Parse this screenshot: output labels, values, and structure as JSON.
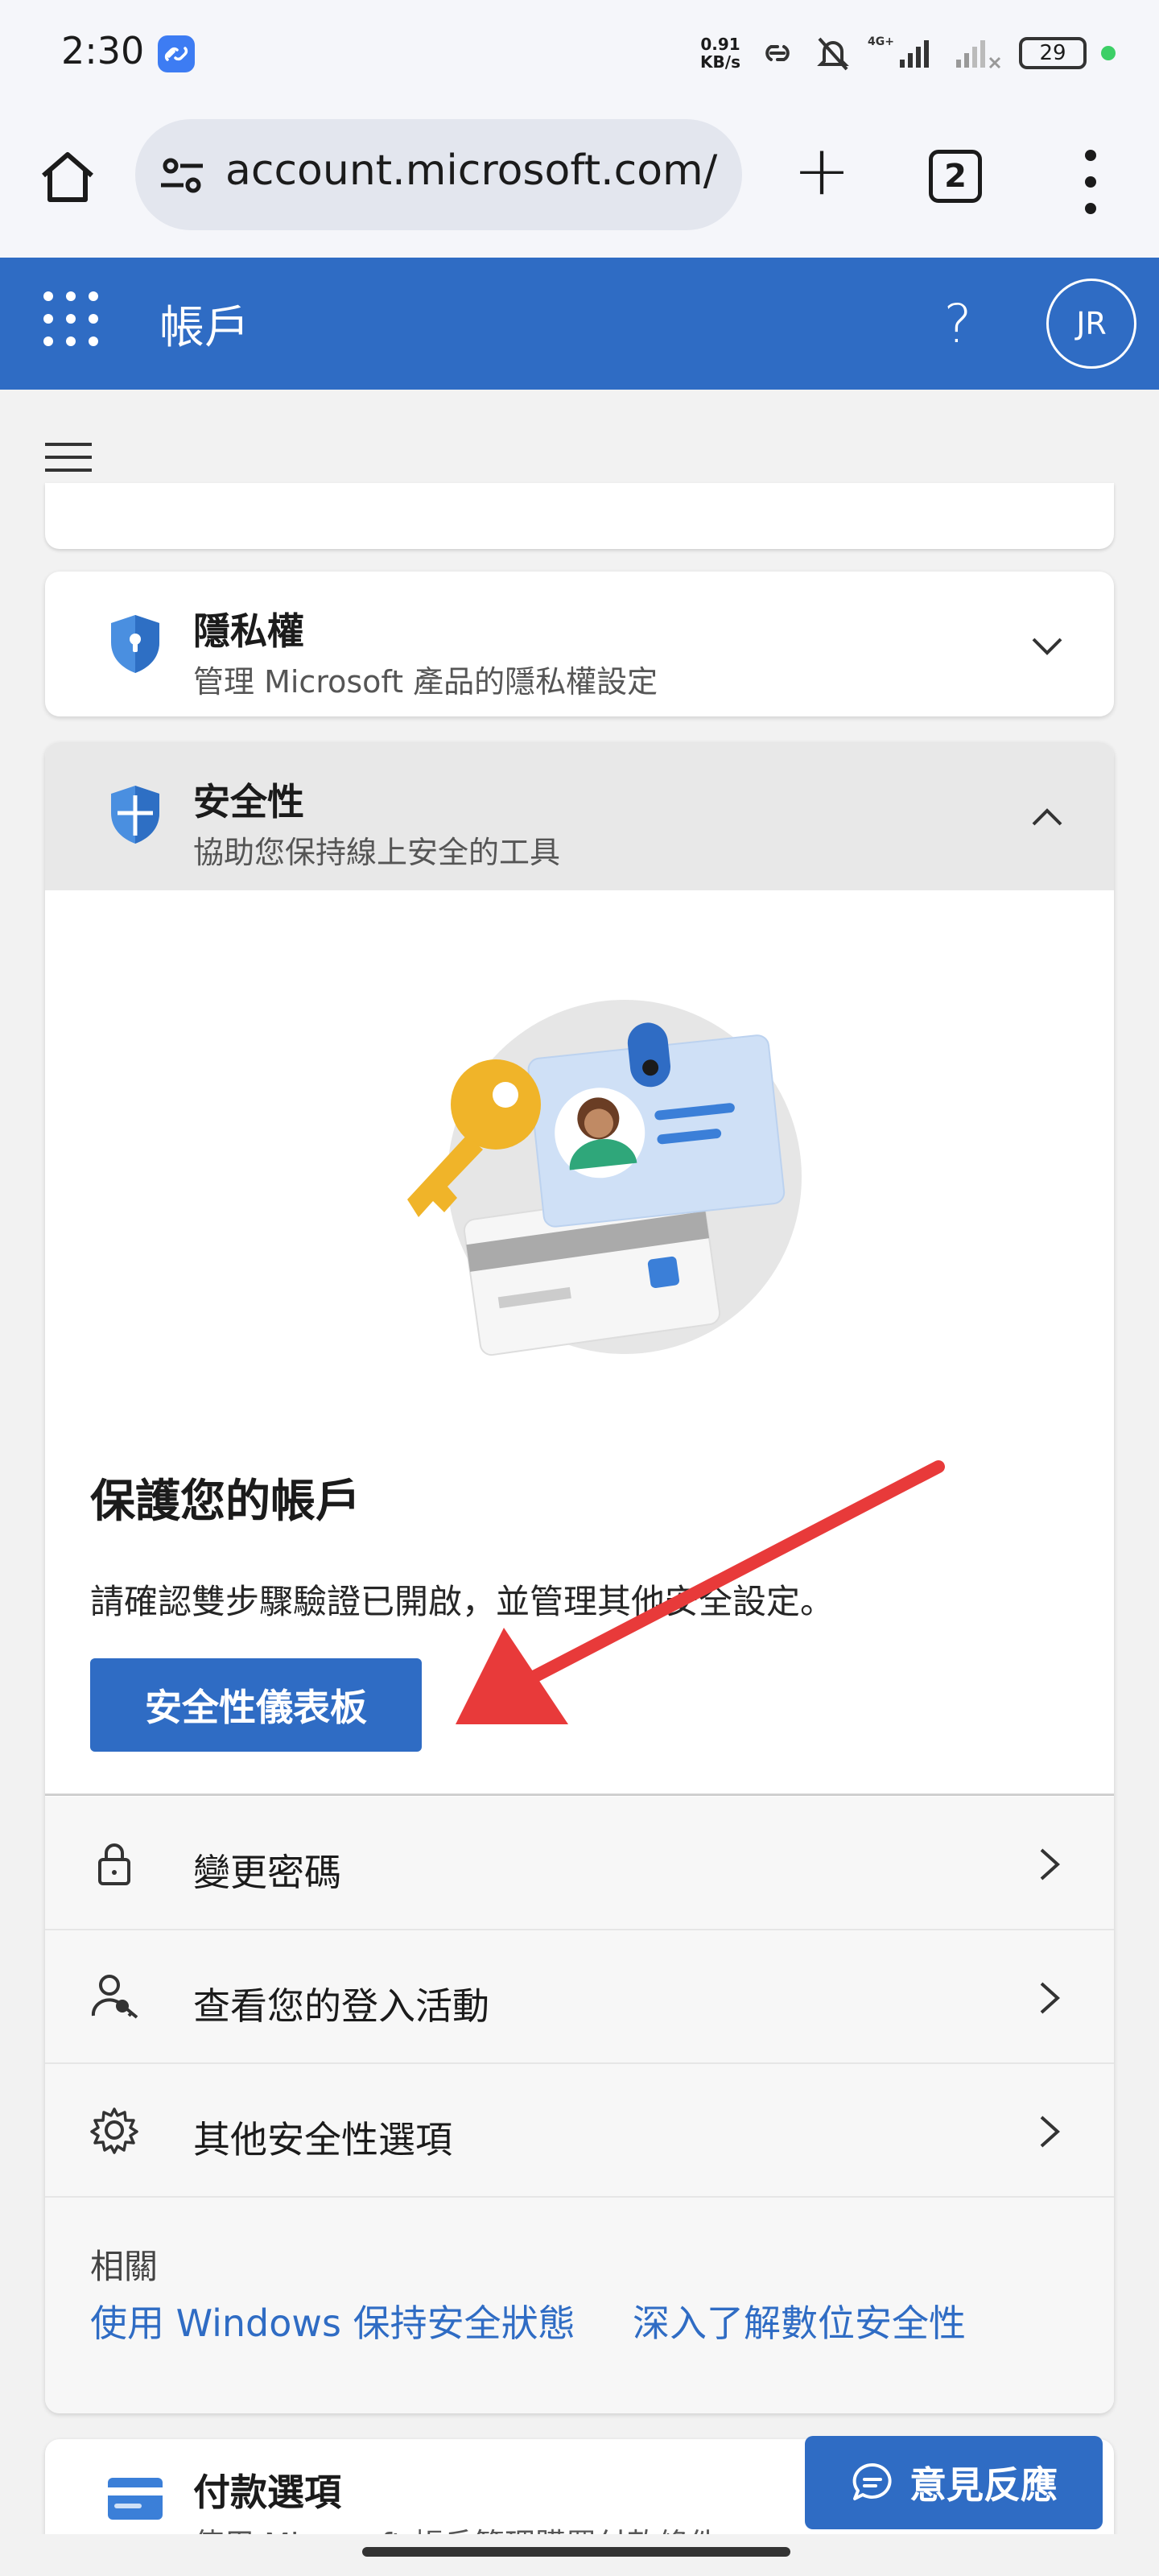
{
  "status_bar": {
    "time": "2:30",
    "net_speed_value": "0.91",
    "net_speed_unit": "KB/s",
    "network_type": "4G+",
    "battery": "29"
  },
  "browser": {
    "url": "account.microsoft.com/",
    "tab_count": "2"
  },
  "header": {
    "title": "帳戶",
    "help_glyph": "?",
    "avatar_initials": "JR",
    "brand_color": "#2f6cc4"
  },
  "privacy": {
    "title": "隱私權",
    "subtitle": "管理 Microsoft 產品的隱私權設定"
  },
  "security": {
    "title": "安全性",
    "subtitle": "協助您保持線上安全的工具",
    "protect_title": "保護您的帳戶",
    "protect_desc": "請確認雙步驟驗證已開啟，並管理其他安全設定。",
    "dashboard_button": "安全性儀表板",
    "rows": [
      {
        "label": "變更密碼",
        "icon": "lock-icon"
      },
      {
        "label": "查看您的登入活動",
        "icon": "user-key-icon"
      },
      {
        "label": "其他安全性選項",
        "icon": "gear-icon"
      }
    ],
    "related_title": "相關",
    "related_links": [
      "使用 Windows 保持安全狀態",
      "深入了解數位安全性"
    ]
  },
  "payment": {
    "title": "付款選項",
    "subtitle": "使用 Microsoft 帳戶管理購買付款條件"
  },
  "feedback": {
    "label": "意見反應"
  }
}
